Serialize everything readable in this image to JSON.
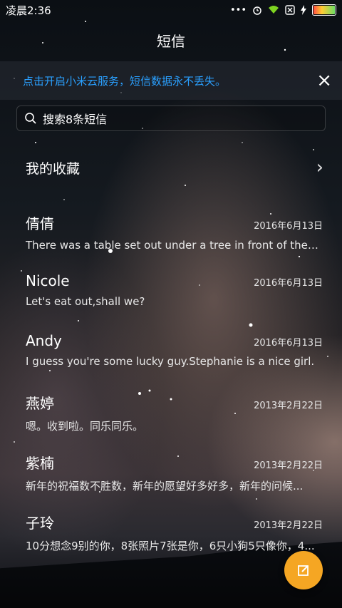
{
  "status": {
    "time": "凌晨2:36",
    "dots": "•••"
  },
  "header": {
    "title": "短信"
  },
  "banner": {
    "text": "点击开启小米云服务，短信数据永不丢失。",
    "close": "×"
  },
  "search": {
    "placeholder": "搜索8条短信"
  },
  "favorites": {
    "label": "我的收藏"
  },
  "conversations": [
    {
      "name": "倩倩",
      "date": "2016年6月13日",
      "message": "There was a table set out under a tree in front of the ho..."
    },
    {
      "name": "Nicole",
      "date": "2016年6月13日",
      "message": "Let's eat out,shall we?"
    },
    {
      "name": "Andy",
      "date": "2016年6月13日",
      "message": "I guess you're some lucky guy.Stephanie is a nice girl."
    },
    {
      "name": "燕婷",
      "date": "2013年2月22日",
      "message": "嗯。收到啦。同乐同乐。"
    },
    {
      "name": "紫楠",
      "date": "2013年2月22日",
      "message": "新年的祝福数不胜数，新年的愿望好多好多，新年的问候..."
    },
    {
      "name": "子玲",
      "date": "2013年2月22日",
      "message": "10分想念9别的你，8张照片7张是你，6只小狗5只像你，4..."
    }
  ],
  "colors": {
    "accent": "#2aa0ff",
    "fab": "#f5a623"
  },
  "icons": {
    "search": "search-icon",
    "compose": "compose-icon",
    "close": "close-icon"
  }
}
